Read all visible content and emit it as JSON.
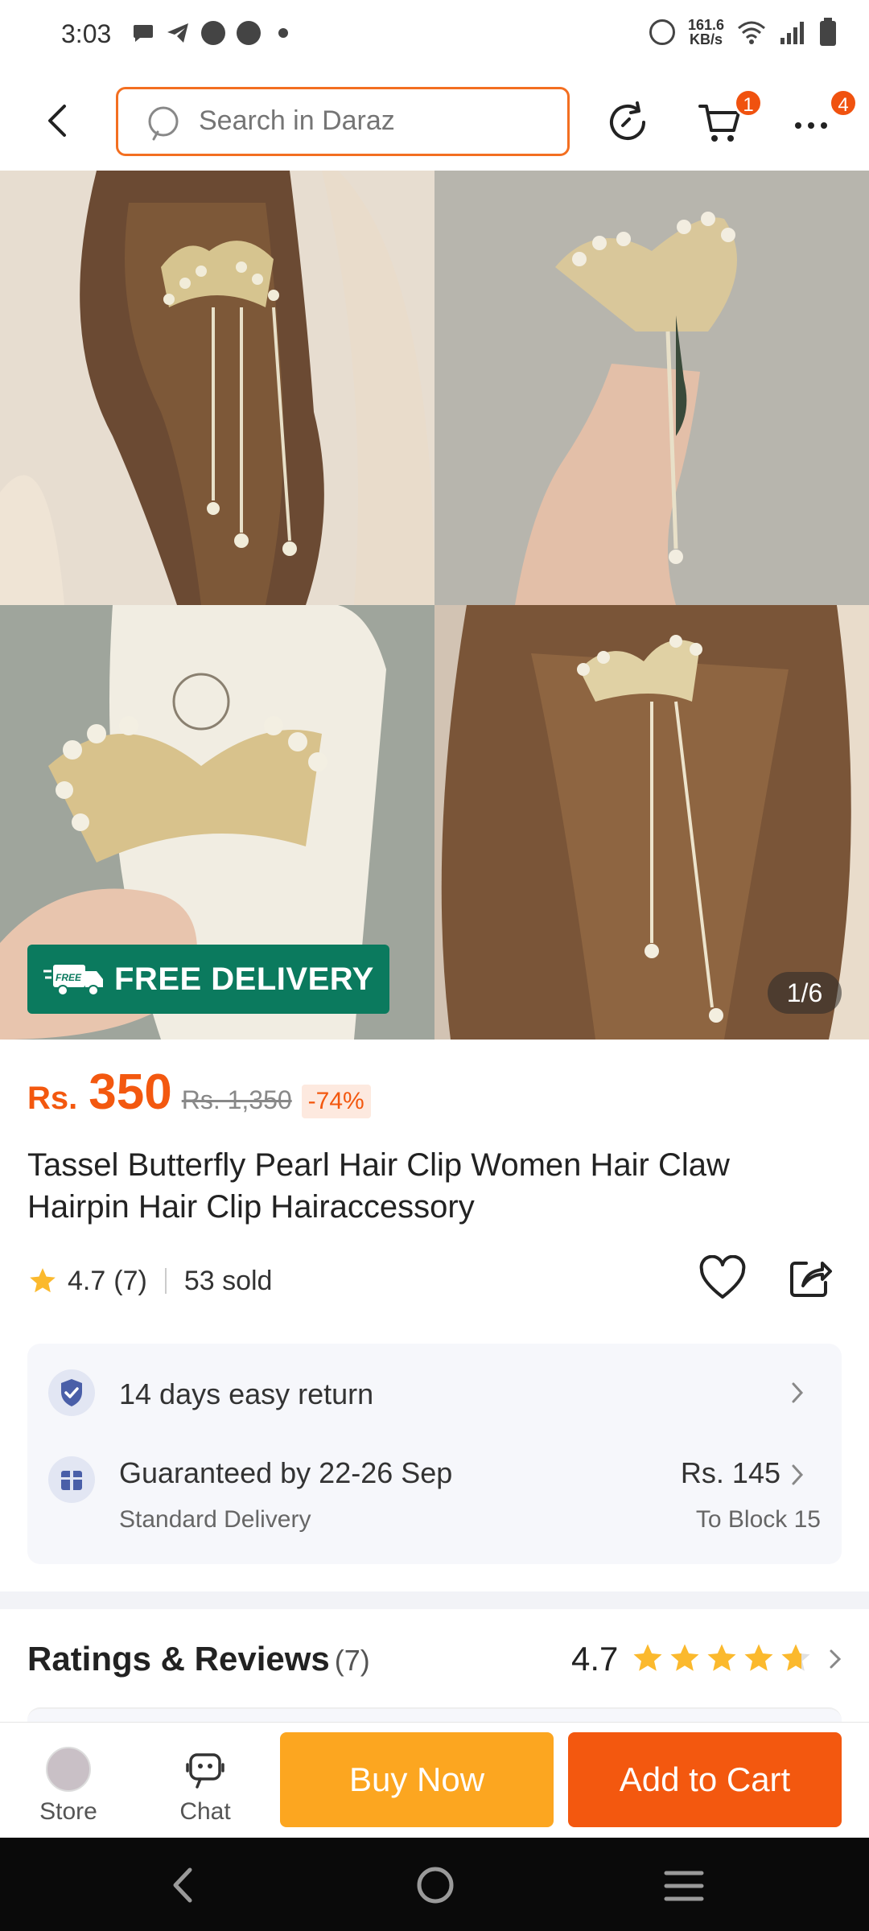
{
  "status_bar": {
    "time": "3:03",
    "net_speed_value": "161.6",
    "net_speed_unit": "KB/s"
  },
  "header": {
    "search_placeholder": "Search in Daraz",
    "cart_badge": "1",
    "more_badge": "4"
  },
  "gallery": {
    "badge_text": "FREE DELIVERY",
    "page_counter": "1/6"
  },
  "price": {
    "currency": "Rs.",
    "value": "350",
    "original": "Rs. 1,350",
    "discount": "-74%"
  },
  "product": {
    "title": "Tassel Butterfly Pearl Hair Clip Women Hair Claw Hairpin Hair Clip Hairaccessory",
    "rating": "4.7",
    "rating_count": "(7)",
    "sold": "53 sold"
  },
  "delivery_card": {
    "return_text": "14 days easy return",
    "guarantee_text": "Guaranteed by 22-26 Sep",
    "delivery_type": "Standard Delivery",
    "delivery_price": "Rs. 145",
    "destination": "To Block 15"
  },
  "ratings_section": {
    "title": "Ratings & Reviews",
    "count": "(7)",
    "score": "4.7"
  },
  "action_bar": {
    "store_label": "Store",
    "chat_label": "Chat",
    "buy_now_label": "Buy Now",
    "add_to_cart_label": "Add to Cart"
  },
  "colors": {
    "brand_orange": "#f3580f",
    "buy_now_yellow": "#fca620",
    "free_delivery_green": "#0b7a5e"
  }
}
